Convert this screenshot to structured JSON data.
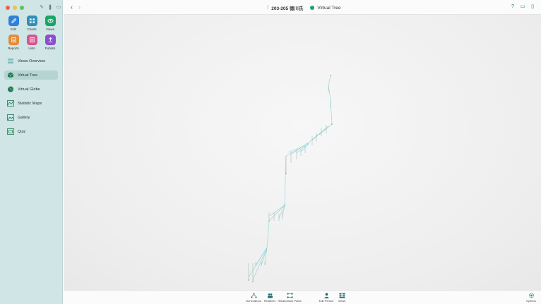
{
  "window": {
    "sidebar": {
      "apps": [
        {
          "label": "Edit",
          "icon": "pencil-icon",
          "color": "#2f80d9"
        },
        {
          "label": "Charts",
          "icon": "charts-icon",
          "color": "#2e8fb8"
        },
        {
          "label": "Views",
          "icon": "eye-icon",
          "color": "#1aa466"
        },
        {
          "label": "Reports",
          "icon": "report-icon",
          "color": "#e58a3a"
        },
        {
          "label": "Lists",
          "icon": "list-icon",
          "color": "#d7558f"
        },
        {
          "label": "Publish",
          "icon": "upload-icon",
          "color": "#8a4fd0"
        }
      ],
      "nav": [
        {
          "label": "Views Overview",
          "icon": "list-lines-icon"
        },
        {
          "label": "Virtual Tree",
          "icon": "cube-icon",
          "active": true
        },
        {
          "label": "Virtual Globe",
          "icon": "globe-icon"
        },
        {
          "label": "Statistic Maps",
          "icon": "map-icon"
        },
        {
          "label": "Gallery",
          "icon": "photo-icon"
        },
        {
          "label": "Quiz",
          "icon": "quiz-icon"
        }
      ]
    },
    "toolbar": {
      "document_title": "203-205 徳川氏",
      "view_title": "Virtual Tree"
    },
    "bottom": {
      "items": [
        {
          "label": "Generations",
          "icon": "generations-icon"
        },
        {
          "label": "Relatives",
          "icon": "relatives-icon"
        },
        {
          "label": "Relationship Paths",
          "icon": "relationship-paths-icon"
        },
        {
          "label": "Edit Person",
          "icon": "person-icon"
        },
        {
          "label": "Views",
          "icon": "views-icon"
        },
        {
          "label": "Options",
          "icon": "gear-icon"
        }
      ]
    },
    "colors": {
      "sidebar_bg": "#cfe5e6",
      "accent": "#1aa466",
      "tree_lines": "#7fd3d0"
    }
  }
}
